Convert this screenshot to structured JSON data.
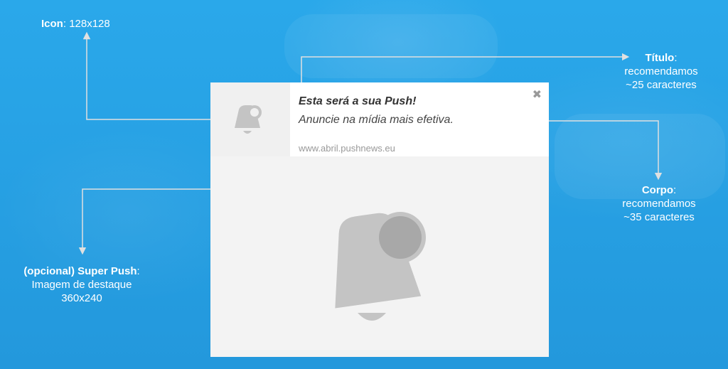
{
  "notification": {
    "title": "Esta será a sua Push!",
    "body": "Anuncie na mídia mais efetiva.",
    "url": "www.abril.pushnews.eu",
    "close": "✖"
  },
  "labels": {
    "icon": {
      "name": "Icon",
      "detail": "128x128"
    },
    "titulo": {
      "name": "Título",
      "line1": "recomendamos",
      "line2": "~25 caracteres"
    },
    "corpo": {
      "name": "Corpo",
      "line1": "recomendamos",
      "line2": "~35 caracteres"
    },
    "superpush": {
      "name": "(opcional) Super Push",
      "line1": "Imagem de destaque",
      "line2": "360x240"
    }
  },
  "colors": {
    "background": "#2ba3e4",
    "annotation_line": "#e0e0e0",
    "placeholder_bell": "#c4c4c4",
    "placeholder_badge": "#a8a8a8"
  },
  "icons": [
    "bell-placeholder-icon",
    "close-icon"
  ]
}
